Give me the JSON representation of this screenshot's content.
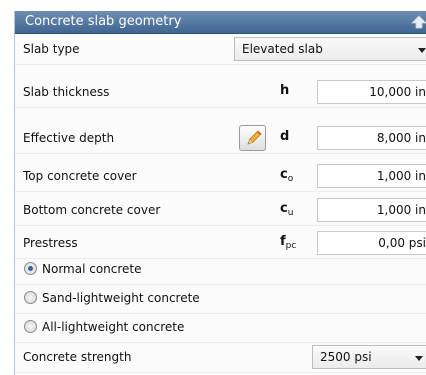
{
  "panel": {
    "title": "Concrete slab geometry",
    "icons": {
      "collapse": "collapse-arrow-up-icon",
      "edit": "pencil-icon",
      "dropdown": "chevron-down-icon"
    }
  },
  "slab_type": {
    "label": "Slab type",
    "value": "Elevated slab"
  },
  "slab_thickness": {
    "label": "Slab thickness",
    "symbol": "h",
    "value": "10,000 in"
  },
  "effective_depth": {
    "label": "Effective depth",
    "symbol": "d",
    "value": "8,000 in"
  },
  "top_cover": {
    "label": "Top concrete cover",
    "symbol": "c",
    "symbol_sub": "o",
    "value": "1,000 in"
  },
  "bottom_cover": {
    "label": "Bottom concrete cover",
    "symbol": "c",
    "symbol_sub": "u",
    "value": "1,000 in"
  },
  "prestress": {
    "label": "Prestress",
    "symbol": "f",
    "symbol_sub": "pc",
    "value": "0,00 psi"
  },
  "concrete_type": {
    "options": [
      {
        "label": "Normal concrete",
        "checked": true
      },
      {
        "label": "Sand-lightweight concrete",
        "checked": false
      },
      {
        "label": "All-lightweight concrete",
        "checked": false
      }
    ]
  },
  "concrete_strength": {
    "label": "Concrete strength",
    "value": "2500 psi"
  },
  "colors": {
    "header": "#3e6592",
    "radio_selected": "#2d5fa6",
    "pencil": "#e8a12a"
  }
}
